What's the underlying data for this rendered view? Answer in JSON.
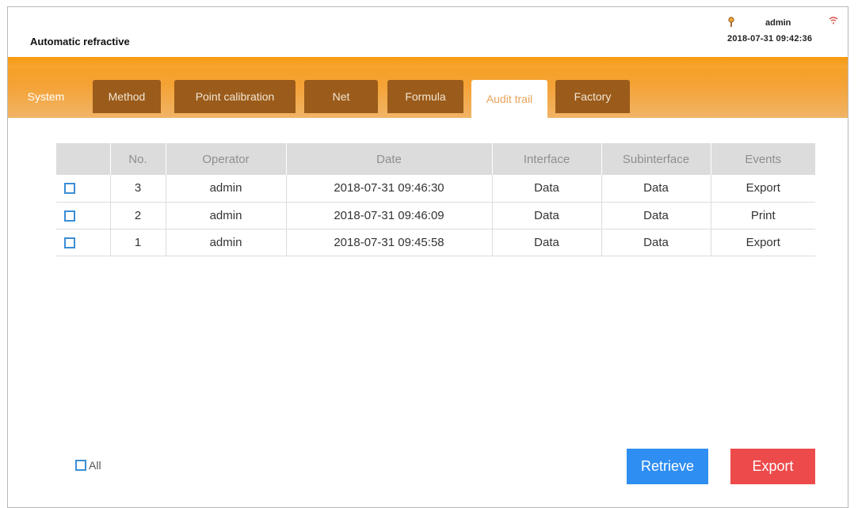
{
  "header": {
    "app_title": "Automatic refractive",
    "user": "admin",
    "datetime": "2018-07-31 09:42:36",
    "icons": {
      "user": "user-pin-icon",
      "network": "wifi-icon"
    }
  },
  "tabs": [
    {
      "label": "System",
      "active": false
    },
    {
      "label": "Method",
      "active": false
    },
    {
      "label": "Point calibration",
      "active": false
    },
    {
      "label": "Net",
      "active": false
    },
    {
      "label": "Formula",
      "active": false
    },
    {
      "label": "Audit trail",
      "active": true
    },
    {
      "label": "Factory",
      "active": false
    }
  ],
  "table": {
    "columns": [
      "No.",
      "Operator",
      "Date",
      "Interface",
      "Subinterface",
      "Events"
    ],
    "rows": [
      {
        "no": "3",
        "operator": "admin",
        "date": "2018-07-31 09:46:30",
        "interface": "Data",
        "subinterface": "Data",
        "event": "Export"
      },
      {
        "no": "2",
        "operator": "admin",
        "date": "2018-07-31 09:46:09",
        "interface": "Data",
        "subinterface": "Data",
        "event": "Print"
      },
      {
        "no": "1",
        "operator": "admin",
        "date": "2018-07-31 09:45:58",
        "interface": "Data",
        "subinterface": "Data",
        "event": "Export"
      }
    ]
  },
  "footer": {
    "select_all_label": "All",
    "retrieve_label": "Retrieve",
    "export_label": "Export"
  },
  "colors": {
    "tabbar": "#f4a234",
    "tab_inactive": "#9b5b1a",
    "checkbox": "#3a8ed6",
    "retrieve": "#2f8ef1",
    "export": "#ed4b4b"
  }
}
